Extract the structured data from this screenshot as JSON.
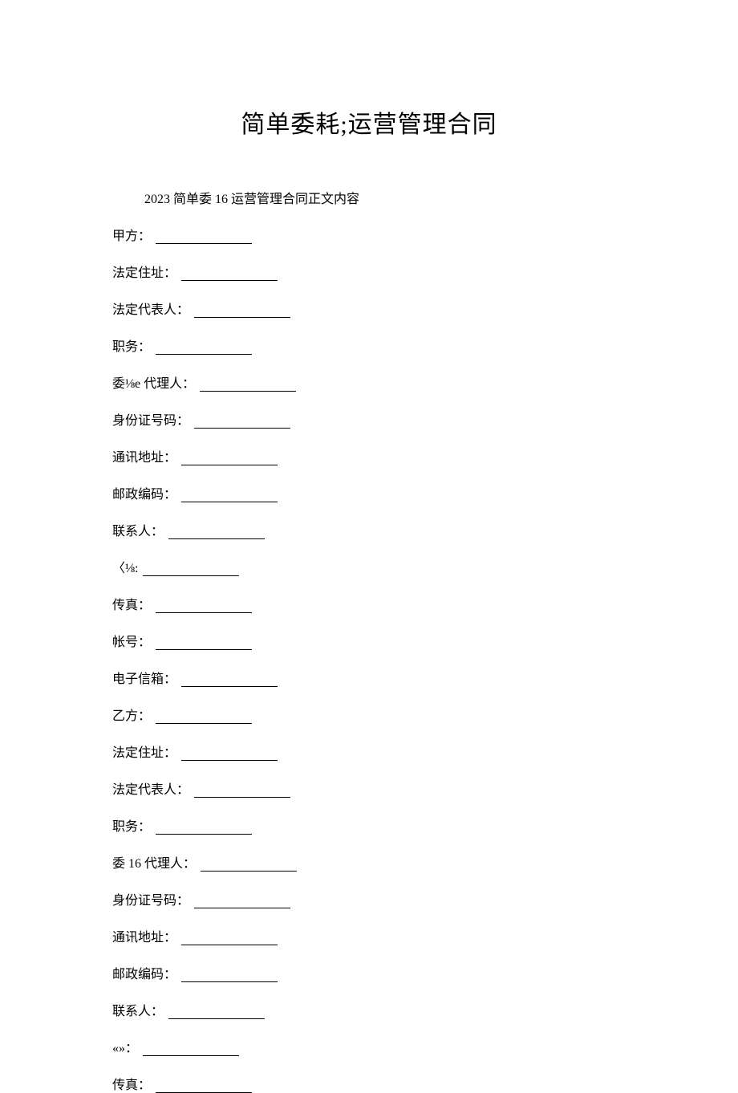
{
  "title": "简单委耗;运营管理合同",
  "subtitle": "2023 简单委 16 运营管理合同正文内容",
  "fields": [
    "甲方：",
    "法定住址：",
    "法定代表人：",
    "职务：",
    "委⅛e 代理人：",
    "身份证号码：",
    "通讯地址：",
    "邮政编码：",
    "联系人：",
    "〈⅛:",
    "传真：",
    "帐号：",
    "电子信箱：",
    "乙方：",
    "法定住址：",
    "法定代表人：",
    "职务：",
    "委 16 代理人：",
    "身份证号码：",
    "通讯地址：",
    "邮政编码：",
    "联系人：",
    "«»：",
    "传真："
  ]
}
